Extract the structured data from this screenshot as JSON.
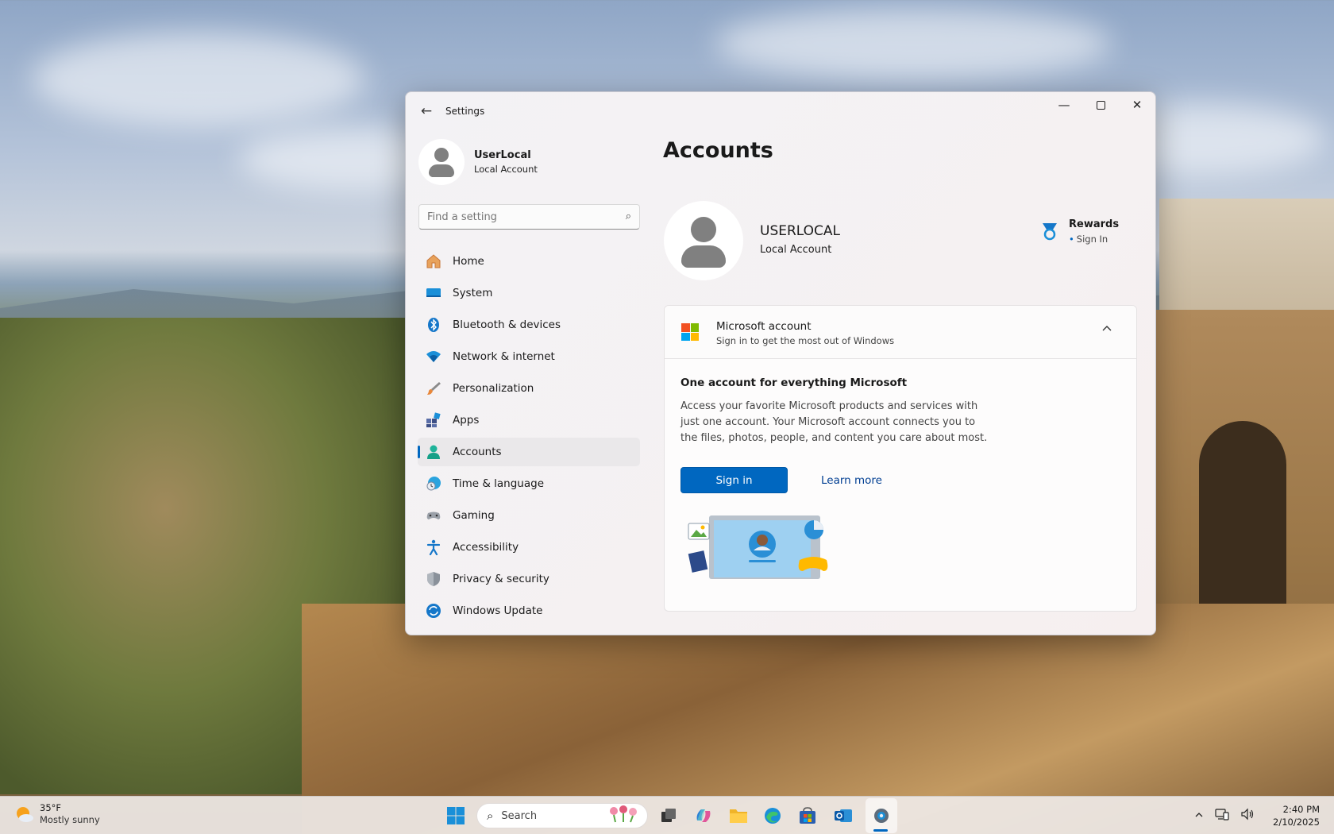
{
  "window": {
    "title": "Settings",
    "controls": {
      "minimize": "—",
      "close": "✕"
    }
  },
  "profile": {
    "name": "UserLocal",
    "type": "Local Account"
  },
  "search": {
    "placeholder": "Find a setting"
  },
  "nav": {
    "items": [
      {
        "label": "Home",
        "icon": "home-icon"
      },
      {
        "label": "System",
        "icon": "system-icon"
      },
      {
        "label": "Bluetooth & devices",
        "icon": "bluetooth-icon"
      },
      {
        "label": "Network & internet",
        "icon": "wifi-icon"
      },
      {
        "label": "Personalization",
        "icon": "brush-icon"
      },
      {
        "label": "Apps",
        "icon": "apps-icon"
      },
      {
        "label": "Accounts",
        "icon": "accounts-icon",
        "active": true
      },
      {
        "label": "Time & language",
        "icon": "clock-globe-icon"
      },
      {
        "label": "Gaming",
        "icon": "gamepad-icon"
      },
      {
        "label": "Accessibility",
        "icon": "accessibility-icon"
      },
      {
        "label": "Privacy & security",
        "icon": "shield-icon"
      },
      {
        "label": "Windows Update",
        "icon": "update-icon"
      }
    ]
  },
  "main": {
    "title": "Accounts",
    "account": {
      "name": "USERLOCAL",
      "type": "Local Account"
    },
    "rewards": {
      "title": "Rewards",
      "status": "Sign In"
    },
    "ms_card": {
      "title": "Microsoft account",
      "subtitle": "Sign in to get the most out of Windows",
      "body_title": "One account for everything Microsoft",
      "body_text": "Access your favorite Microsoft products and services with just one account. Your Microsoft account connects you to the files, photos, people, and content you care about most.",
      "signin_label": "Sign in",
      "learn_more_label": "Learn more"
    }
  },
  "taskbar": {
    "weather": {
      "temp": "35°F",
      "desc": "Mostly sunny"
    },
    "search_label": "Search",
    "clock": {
      "time": "2:40 PM",
      "date": "2/10/2025"
    }
  },
  "colors": {
    "accent": "#0067c0",
    "link": "#003e92"
  }
}
